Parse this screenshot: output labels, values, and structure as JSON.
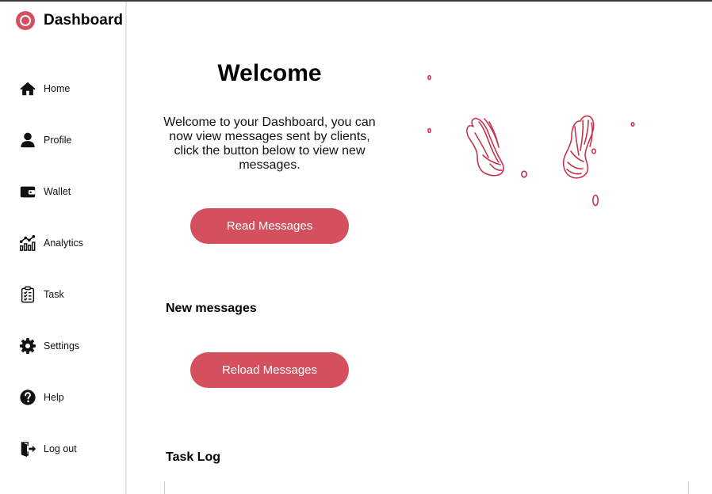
{
  "sidebar": {
    "title": "Dashboard",
    "items": [
      {
        "label": "Home",
        "icon": "home-icon"
      },
      {
        "label": "Profile",
        "icon": "user-icon"
      },
      {
        "label": "Wallet",
        "icon": "wallet-icon"
      },
      {
        "label": "Analytics",
        "icon": "analytics-icon"
      },
      {
        "label": "Task",
        "icon": "clipboard-icon"
      },
      {
        "label": "Settings",
        "icon": "gear-icon"
      },
      {
        "label": "Help",
        "icon": "help-icon"
      },
      {
        "label": "Log out",
        "icon": "logout-icon"
      }
    ]
  },
  "main": {
    "welcome_title": "Welcome",
    "welcome_text": "Welcome to your Dashboard, you can now view messages sent by clients, click the button below to view new messages.",
    "read_button": "Read Messages",
    "new_messages_heading": "New messages",
    "reload_button": "Reload Messages",
    "task_log_heading": "Task Log"
  },
  "colors": {
    "accent": "#d4505e",
    "illustration": "#c8344e",
    "sidebar_border": "#e6e6e6"
  }
}
